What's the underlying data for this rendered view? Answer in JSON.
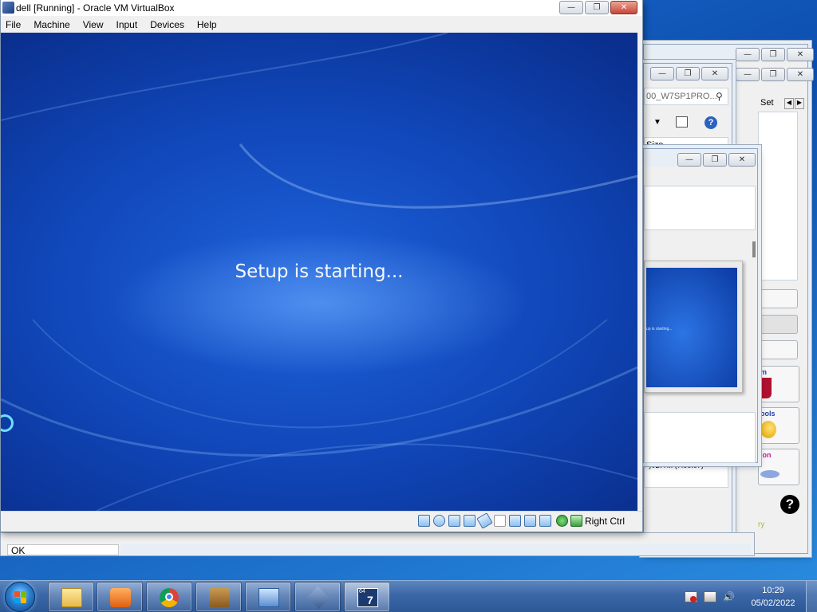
{
  "vm_window": {
    "title": "dell [Running] - Oracle VM VirtualBox",
    "menu": [
      "File",
      "Machine",
      "Input",
      "View",
      "Devices",
      "Help"
    ],
    "menu_order_note": "",
    "screen_text": "Setup is starting...",
    "host_key_label": "Right Ctrl"
  },
  "menus": {
    "file": "File",
    "machine": "Machine",
    "view": "View",
    "input": "Input",
    "devices": "Devices",
    "help": "Help"
  },
  "background_windows": {
    "explorer_search_text": "00_W7SP1PRO...",
    "size_column": "Size",
    "set_tab": "Set",
    "ok_text": "OK",
    "preview_text": "up is starting...",
    "partial_label_1": "m",
    "partial_label_2": "ools",
    "partial_label_3": "ion",
    "partial_label_4": "ry",
    "partial_row": ">)\\/DA ... (7.00.07)"
  },
  "taskbar": {
    "time": "10:29",
    "date": "05/02/2022",
    "apps": [
      "file-explorer",
      "media-player",
      "chrome",
      "toolbox",
      "remote-desktop",
      "virtualbox",
      "windows7-64bit"
    ],
    "badge_64": "64",
    "badge_7": "7"
  },
  "colors": {
    "vm_screen_blue": "#1046b8",
    "taskbar_blue": "#3b67a8",
    "close_red": "#c8463a"
  }
}
